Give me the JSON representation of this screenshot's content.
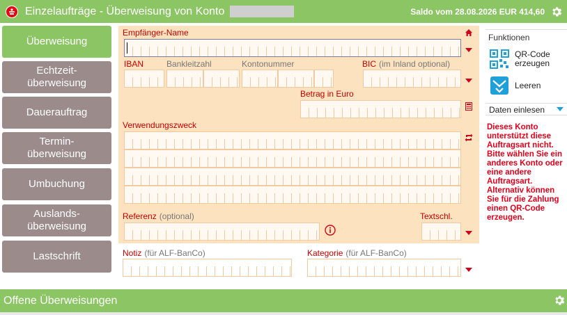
{
  "header": {
    "title": "Einzelaufträge - Überweisung von Konto",
    "saldo": "Saldo vom 28.08.2026 EUR 414,60"
  },
  "nav": {
    "items": [
      {
        "label": "Überweisung",
        "active": true
      },
      {
        "label": "Echtzeit-\nüberweisung"
      },
      {
        "label": "Dauerauftrag"
      },
      {
        "label": "Termin-\nüberweisung"
      },
      {
        "label": "Umbuchung"
      },
      {
        "label": "Auslands-\nüberweisung"
      },
      {
        "label": "Lastschrift"
      }
    ]
  },
  "form": {
    "empfaenger_label": "Empfänger-Name",
    "iban_label": "IBAN",
    "blz_label": "Bankleitzahl",
    "konto_label": "Kontonummer",
    "bic_label": "BIC",
    "bic_optional": "(im Inland optional)",
    "betrag_label": "Betrag in Euro",
    "verwendung_label": "Verwendungszweck",
    "referenz_label": "Referenz",
    "referenz_optional": "(optional)",
    "textschl_label": "Textschl.",
    "notiz_label": "Notiz",
    "notiz_optional": "(für ALF-BanCo)",
    "kategorie_label": "Kategorie",
    "kategorie_optional": "(für ALF-BanCo)"
  },
  "functions": {
    "title": "Funktionen",
    "qr_label": "QR-Code erzeugen",
    "clear_label": "Leeren",
    "daten_label": "Daten einlesen",
    "warning": "Dieses Konto unterstützt diese Auftragsart nicht. Bitte wählen Sie ein anderes Konto oder eine andere Auftragsart. Alternativ können Sie für die Zahlung einen QR-Code erzeugen."
  },
  "footer": {
    "title": "Offene Überweisungen"
  },
  "colors": {
    "green": "#8cc564",
    "nav_gray": "#9b8b8b",
    "form_bg": "#fde2c0",
    "label_red": "#c00000",
    "warning_red": "#e0001b",
    "accent_blue": "#1fa0d8"
  }
}
